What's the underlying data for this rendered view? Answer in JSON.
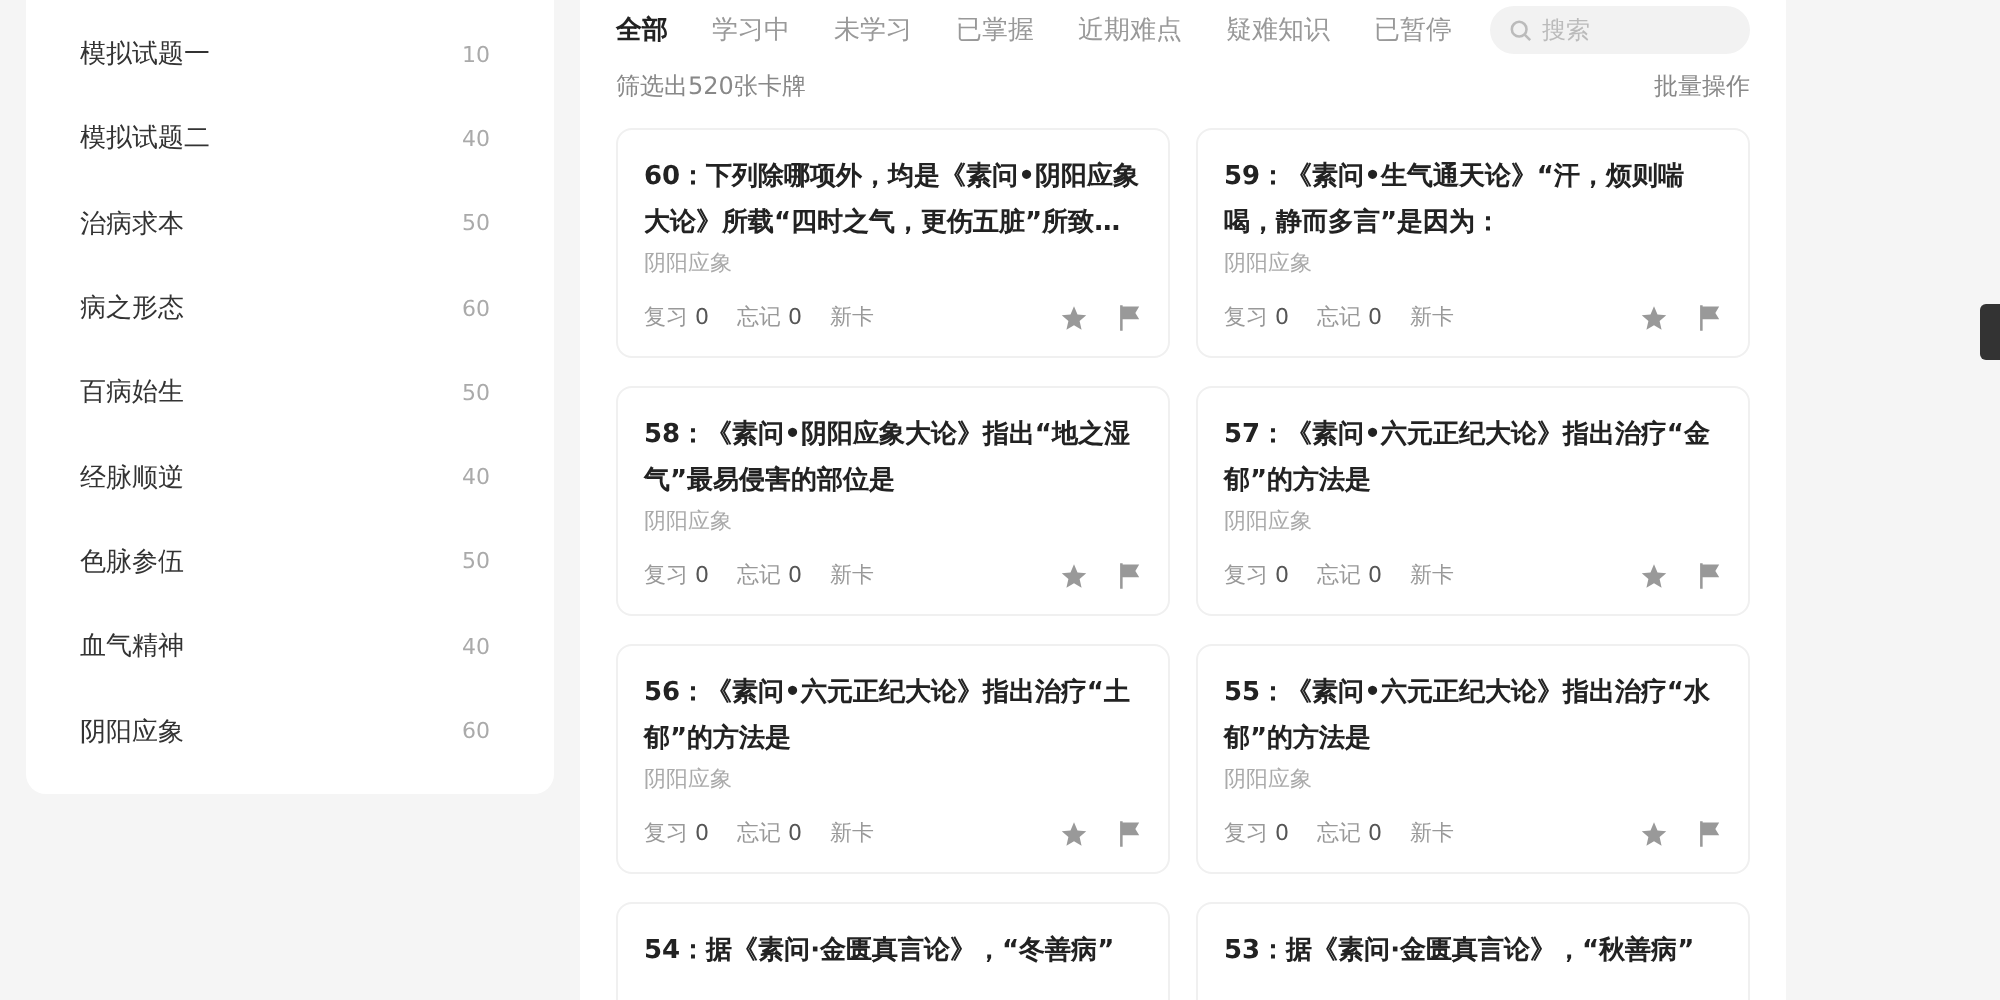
{
  "sidebar": {
    "items": [
      {
        "label": "模拟试题一",
        "count": "10"
      },
      {
        "label": "模拟试题二",
        "count": "40"
      },
      {
        "label": "治病求本",
        "count": "50"
      },
      {
        "label": "病之形态",
        "count": "60"
      },
      {
        "label": "百病始生",
        "count": "50"
      },
      {
        "label": "经脉顺逆",
        "count": "40"
      },
      {
        "label": "色脉参伍",
        "count": "50"
      },
      {
        "label": "血气精神",
        "count": "40"
      },
      {
        "label": "阴阳应象",
        "count": "60"
      }
    ]
  },
  "tabs": [
    {
      "label": "全部",
      "selected": true
    },
    {
      "label": "学习中",
      "selected": false
    },
    {
      "label": "未学习",
      "selected": false
    },
    {
      "label": "已掌握",
      "selected": false
    },
    {
      "label": "近期难点",
      "selected": false
    },
    {
      "label": "疑难知识",
      "selected": false
    },
    {
      "label": "已暂停",
      "selected": false
    }
  ],
  "search": {
    "placeholder": "搜索"
  },
  "filter_summary": "筛选出520张卡牌",
  "batch_action": "批量操作",
  "cards": [
    {
      "title": "60：下列除哪项外，均是《素问•阴阳应象大论》所载“四时之气，更伤五脏”所致…",
      "category": "阴阳应象",
      "review_label": "复习",
      "review": "0",
      "forget_label": "忘记",
      "forget": "0",
      "status": "新卡",
      "starred": false,
      "flagged": false
    },
    {
      "title": "59：《素问•生气通天论》“汗，烦则喘喝，静而多言”是因为：",
      "category": "阴阳应象",
      "review_label": "复习",
      "review": "0",
      "forget_label": "忘记",
      "forget": "0",
      "status": "新卡",
      "starred": false,
      "flagged": false
    },
    {
      "title": "58：《素问•阴阳应象大论》指出“地之湿气”最易侵害的部位是",
      "category": "阴阳应象",
      "review_label": "复习",
      "review": "0",
      "forget_label": "忘记",
      "forget": "0",
      "status": "新卡",
      "starred": false,
      "flagged": false
    },
    {
      "title": "57：《素问•六元正纪大论》指出治疗“金郁”的方法是",
      "category": "阴阳应象",
      "review_label": "复习",
      "review": "0",
      "forget_label": "忘记",
      "forget": "0",
      "status": "新卡",
      "starred": false,
      "flagged": false
    },
    {
      "title": "56：《素问•六元正纪大论》指出治疗“土郁”的方法是",
      "category": "阴阳应象",
      "review_label": "复习",
      "review": "0",
      "forget_label": "忘记",
      "forget": "0",
      "status": "新卡",
      "starred": false,
      "flagged": false
    },
    {
      "title": "55：《素问•六元正纪大论》指出治疗“水郁”的方法是",
      "category": "阴阳应象",
      "review_label": "复习",
      "review": "0",
      "forget_label": "忘记",
      "forget": "0",
      "status": "新卡",
      "starred": false,
      "flagged": false
    },
    {
      "title": "54：据《素问·金匮真言论》，“冬善病”"
    },
    {
      "title": "53：据《素问·金匮真言论》，“秋善病”"
    }
  ]
}
